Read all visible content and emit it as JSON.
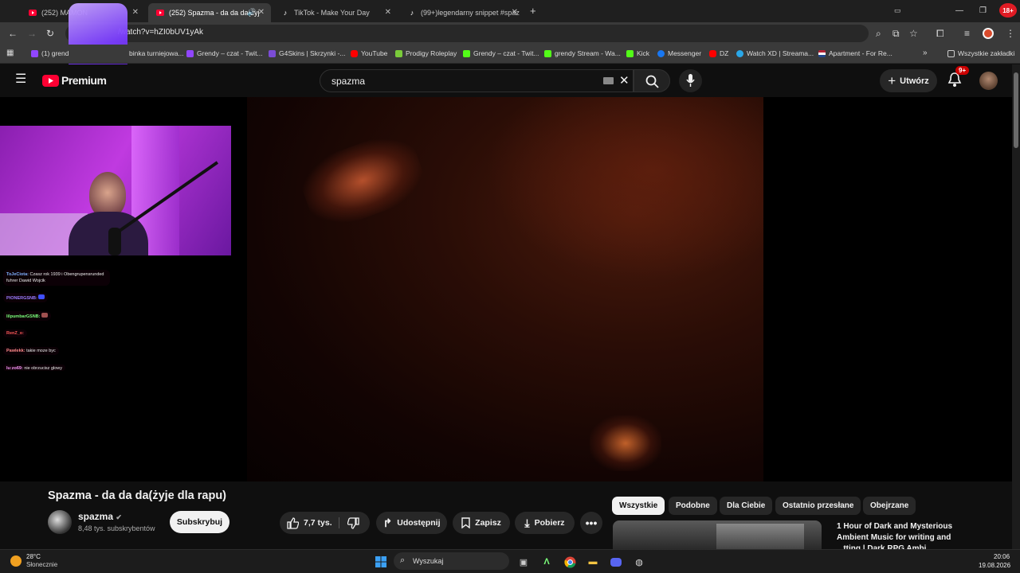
{
  "browser": {
    "tabs": [
      {
        "title": "(252) MAMON",
        "active": false
      },
      {
        "title": "(252) Spazma - da da da(żyj",
        "active": true
      },
      {
        "title": "TikTok - Make Your Day",
        "active": false
      },
      {
        "title": "(99+)legendarny snippet #spaz",
        "active": false
      }
    ],
    "url": "/watch?v=hZI0bUV1yAk",
    "bookmarks": [
      {
        "label": "(1) grend",
        "color": "#9146ff"
      },
      {
        "label": "binka turniejowa...",
        "color": "#9146ff"
      },
      {
        "label": "Grendy – czat - Twit...",
        "color": "#9146ff"
      },
      {
        "label": "G4Skins | Skrzynki -...",
        "color": "#7b4cd6"
      },
      {
        "label": "YouTube",
        "color": "#ff0000"
      },
      {
        "label": "Prodigy Roleplay",
        "color": "#7acb3a"
      },
      {
        "label": "Grendy – czat - Twit...",
        "color": "#53fc18"
      },
      {
        "label": "grendy Stream - Wa...",
        "color": "#53fc18"
      },
      {
        "label": "Kick",
        "color": "#53fc18"
      },
      {
        "label": "Messenger",
        "color": "#1877f2"
      },
      {
        "label": "DZ",
        "color": "#ff0000"
      },
      {
        "label": "Watch XD | Streama...",
        "color": "#2aa7e8"
      },
      {
        "label": "Apartment - For Re...",
        "color": "#b22234"
      }
    ],
    "all_bookmarks_label": "Wszystkie zakładki"
  },
  "youtube": {
    "logo_text": "Premium",
    "search_value": "spazma",
    "create_label": "Utwórz",
    "notif_badge": "9+",
    "video_title": "Spazma - da da da(żyje dla rapu)",
    "channel_name": "spazma",
    "subscribers": "8,48 tys. subskrybentów",
    "subscribe_label": "Subskrybuj",
    "like_count": "7,7 tys.",
    "share_label": "Udostępnij",
    "save_label": "Zapisz",
    "download_label": "Pobierz",
    "chips": [
      "Wszystkie",
      "Podobne",
      "Dla Ciebie",
      "Ostatnio przesłane",
      "Obejrzane"
    ],
    "rec_title": "1 Hour of Dark and Mysterious Ambient Music for writing and",
    "rec_title_2": "...tting | Dark RPG Ambi..."
  },
  "overlay_chat": [
    {
      "user": "ToJeCiota:",
      "msg": "Czasz rok 1939 i Obengrupensrunded fuhrer Dawid Wojcik",
      "color": "#7fb0ff"
    },
    {
      "user": "PIONERGSNB:",
      "msg": "",
      "color": "#9d7dff"
    },
    {
      "user": "lilpumbarGSNB:",
      "msg": "",
      "color": "#7aff7a"
    },
    {
      "user": "RenZ_o:",
      "msg": "",
      "color": "#ff5a5a"
    },
    {
      "user": "Pawlekk:",
      "msg": "takie moze byc",
      "color": "#ff8a8a"
    },
    {
      "user": "lu:zo69:",
      "msg": "nie obrzucisz glowy",
      "color": "#ff9aff"
    }
  ],
  "taskbar": {
    "weather_temp": "28°C",
    "weather_desc": "Słonecznie",
    "search_label": "Wyszukaj",
    "time": "20:06",
    "date": "19.08.2026"
  }
}
